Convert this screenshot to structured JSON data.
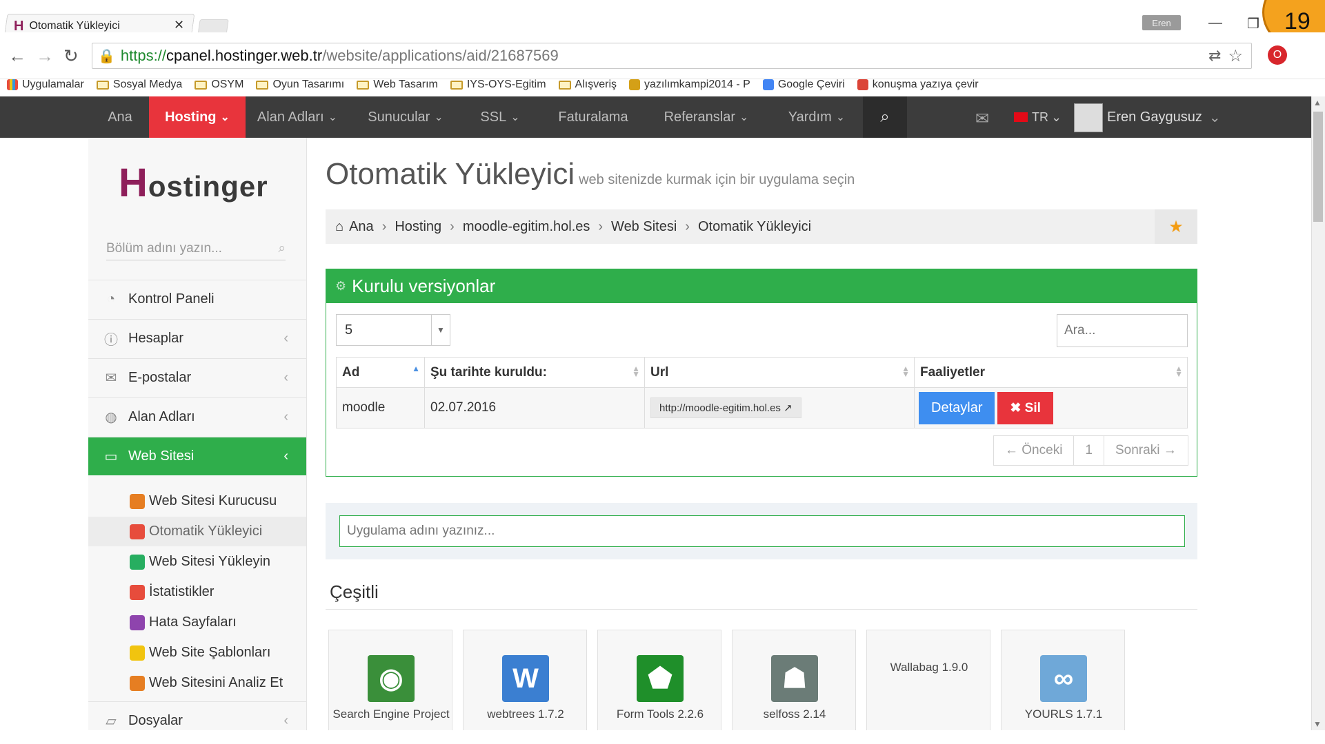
{
  "browser": {
    "tab_title": "Otomatik Yükleyici",
    "tab_close": "✕",
    "user_chip": "Eren",
    "badge_number": "19",
    "url_proto": "https://",
    "url_host": "cpanel.hostinger.web.tr",
    "url_path": "/website/applications/aid/21687569",
    "bookmarks": [
      {
        "label": "Uygulamalar",
        "icon": "apps-grid-icon"
      },
      {
        "label": "Sosyal Medya",
        "icon": "folder-icon"
      },
      {
        "label": "OSYM",
        "icon": "folder-icon"
      },
      {
        "label": "Oyun Tasarımı",
        "icon": "folder-icon"
      },
      {
        "label": "Web Tasarım",
        "icon": "folder-icon"
      },
      {
        "label": "IYS-OYS-Egitim",
        "icon": "folder-icon"
      },
      {
        "label": "Alışveriş",
        "icon": "folder-icon"
      },
      {
        "label": "yazılımkampi2014 - P",
        "icon": "site-icon"
      },
      {
        "label": "Google Çeviri",
        "icon": "translate-icon"
      },
      {
        "label": "konuşma yazıya çevir",
        "icon": "chrome-icon"
      }
    ]
  },
  "nav": {
    "items": [
      "Ana",
      "Hosting",
      "Alan Adları",
      "Sunucular",
      "SSL",
      "Faturalama",
      "Referanslar",
      "Yardım"
    ],
    "active": "Hosting",
    "lang": "TR",
    "user": "Eren Gaygusuz",
    "chev": "⌄"
  },
  "sidebar": {
    "logo_rest": "ostinger",
    "search_placeholder": "Bölüm adını yazın...",
    "items": [
      {
        "label": "Kontrol Paneli",
        "icon": "dashboard-icon"
      },
      {
        "label": "Hesaplar",
        "icon": "info-icon"
      },
      {
        "label": "E-postalar",
        "icon": "envelope-icon"
      },
      {
        "label": "Alan Adları",
        "icon": "globe-icon"
      },
      {
        "label": "Web Sitesi",
        "icon": "monitor-icon"
      },
      {
        "label": "Dosyalar",
        "icon": "folder-open-icon"
      }
    ],
    "subitems": [
      {
        "label": "Web Sitesi Kurucusu",
        "color": "#e67e22"
      },
      {
        "label": "Otomatik Yükleyici",
        "color": "#e74c3c"
      },
      {
        "label": "Web Sitesi Yükleyin",
        "color": "#27ae60"
      },
      {
        "label": "İstatistikler",
        "color": "#e74c3c"
      },
      {
        "label": "Hata Sayfaları",
        "color": "#8e44ad"
      },
      {
        "label": "Web Site Şablonları",
        "color": "#f1c40f"
      },
      {
        "label": "Web Sitesini Analiz Et",
        "color": "#e67e22"
      }
    ]
  },
  "main": {
    "title": "Otomatik Yükleyici",
    "subtitle": "web sitenizde kurmak için bir uygulama seçin",
    "breadcrumb": [
      "Ana",
      "Hosting",
      "moodle-egitim.hol.es",
      "Web Sitesi",
      "Otomatik Yükleyici"
    ],
    "panel_title": "Kurulu versiyonlar",
    "page_size": "5",
    "search_placeholder": "Ara...",
    "table": {
      "headers": [
        "Ad",
        "Şu tarihte kuruldu:",
        "Url",
        "Faaliyetler"
      ],
      "rows": [
        {
          "name": "moodle",
          "date": "02.07.2016",
          "url": "http://moodle-egitim.hol.es",
          "details": "Detaylar",
          "delete": "✖ Sil"
        }
      ]
    },
    "pager": {
      "prev": "← Önceki",
      "page": "1",
      "next": "Sonraki →"
    },
    "app_search_placeholder": "Uygulama adını yazınız...",
    "section_title": "Çeşitli",
    "apps": [
      {
        "label": "Search Engine Project",
        "icon": "magnifier-eye-icon",
        "color": "#3a8f3a"
      },
      {
        "label": "webtrees 1.7.2",
        "icon": "w-logo-icon",
        "color": "#3b7fd1"
      },
      {
        "label": "Form Tools 2.2.6",
        "icon": "green-gem-icon",
        "color": "#1f8f2a"
      },
      {
        "label": "selfoss 2.14",
        "icon": "robot-icon",
        "color": "#6b7c77"
      },
      {
        "label": "Wallabag 1.9.0",
        "icon": "none",
        "color": "#f7f7f7"
      },
      {
        "label": "YOURLS 1.7.1",
        "icon": "yourls-icon",
        "color": "#6fa8d8"
      }
    ]
  },
  "colors": {
    "brand_red": "#e8343c",
    "brand_green": "#2fae4b",
    "nav_bg": "#3c3c3c",
    "button_blue": "#3e8ef0"
  }
}
